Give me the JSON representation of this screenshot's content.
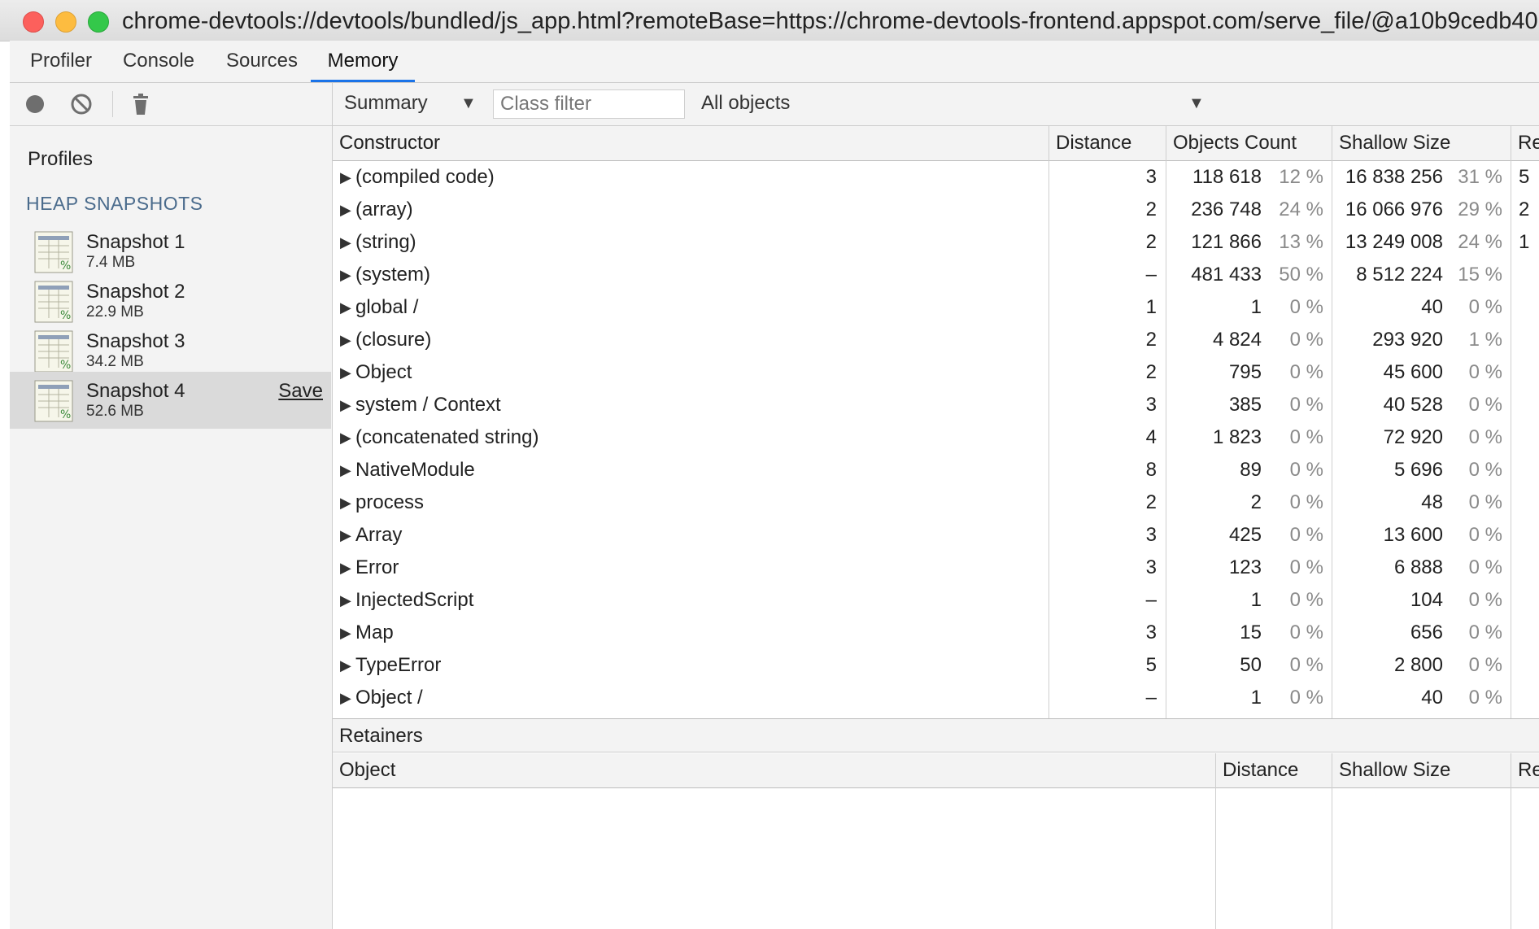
{
  "window": {
    "url": "chrome-devtools://devtools/bundled/js_app.html?remoteBase=https://chrome-devtools-frontend.appspot.com/serve_file/@a10b9cedb40738cb152f"
  },
  "tabs": [
    {
      "label": "Profiler"
    },
    {
      "label": "Console"
    },
    {
      "label": "Sources"
    },
    {
      "label": "Memory",
      "active": true
    }
  ],
  "sidebar": {
    "profiles_label": "Profiles",
    "section_label": "HEAP SNAPSHOTS",
    "snapshots": [
      {
        "name": "Snapshot 1",
        "size": "7.4 MB"
      },
      {
        "name": "Snapshot 2",
        "size": "22.9 MB"
      },
      {
        "name": "Snapshot 3",
        "size": "34.2 MB"
      },
      {
        "name": "Snapshot 4",
        "size": "52.6 MB",
        "selected": true,
        "save_label": "Save"
      }
    ]
  },
  "filterbar": {
    "view": "Summary",
    "class_filter_placeholder": "Class filter",
    "objects": "All objects"
  },
  "table": {
    "headers": {
      "constructor": "Constructor",
      "distance": "Distance",
      "objects_count": "Objects Count",
      "shallow_size": "Shallow Size",
      "retained": "Re"
    },
    "rows": [
      {
        "name": "(compiled code)",
        "distance": "3",
        "count": "118 618",
        "count_pct": "12 %",
        "shallow": "16 838 256",
        "shallow_pct": "31 %",
        "retained": "5"
      },
      {
        "name": "(array)",
        "distance": "2",
        "count": "236 748",
        "count_pct": "24 %",
        "shallow": "16 066 976",
        "shallow_pct": "29 %",
        "retained": "2"
      },
      {
        "name": "(string)",
        "distance": "2",
        "count": "121 866",
        "count_pct": "13 %",
        "shallow": "13 249 008",
        "shallow_pct": "24 %",
        "retained": "1"
      },
      {
        "name": "(system)",
        "distance": "–",
        "count": "481 433",
        "count_pct": "50 %",
        "shallow": "8 512 224",
        "shallow_pct": "15 %",
        "retained": ""
      },
      {
        "name": "global /",
        "distance": "1",
        "count": "1",
        "count_pct": "0 %",
        "shallow": "40",
        "shallow_pct": "0 %",
        "retained": ""
      },
      {
        "name": "(closure)",
        "distance": "2",
        "count": "4 824",
        "count_pct": "0 %",
        "shallow": "293 920",
        "shallow_pct": "1 %",
        "retained": ""
      },
      {
        "name": "Object",
        "distance": "2",
        "count": "795",
        "count_pct": "0 %",
        "shallow": "45 600",
        "shallow_pct": "0 %",
        "retained": ""
      },
      {
        "name": "system / Context",
        "distance": "3",
        "count": "385",
        "count_pct": "0 %",
        "shallow": "40 528",
        "shallow_pct": "0 %",
        "retained": ""
      },
      {
        "name": "(concatenated string)",
        "distance": "4",
        "count": "1 823",
        "count_pct": "0 %",
        "shallow": "72 920",
        "shallow_pct": "0 %",
        "retained": ""
      },
      {
        "name": "NativeModule",
        "distance": "8",
        "count": "89",
        "count_pct": "0 %",
        "shallow": "5 696",
        "shallow_pct": "0 %",
        "retained": ""
      },
      {
        "name": "process",
        "distance": "2",
        "count": "2",
        "count_pct": "0 %",
        "shallow": "48",
        "shallow_pct": "0 %",
        "retained": ""
      },
      {
        "name": "Array",
        "distance": "3",
        "count": "425",
        "count_pct": "0 %",
        "shallow": "13 600",
        "shallow_pct": "0 %",
        "retained": ""
      },
      {
        "name": "Error",
        "distance": "3",
        "count": "123",
        "count_pct": "0 %",
        "shallow": "6 888",
        "shallow_pct": "0 %",
        "retained": ""
      },
      {
        "name": "InjectedScript",
        "distance": "–",
        "count": "1",
        "count_pct": "0 %",
        "shallow": "104",
        "shallow_pct": "0 %",
        "retained": ""
      },
      {
        "name": "Map",
        "distance": "3",
        "count": "15",
        "count_pct": "0 %",
        "shallow": "656",
        "shallow_pct": "0 %",
        "retained": ""
      },
      {
        "name": "TypeError",
        "distance": "5",
        "count": "50",
        "count_pct": "0 %",
        "shallow": "2 800",
        "shallow_pct": "0 %",
        "retained": ""
      },
      {
        "name": "Object /",
        "distance": "–",
        "count": "1",
        "count_pct": "0 %",
        "shallow": "40",
        "shallow_pct": "0 %",
        "retained": ""
      }
    ]
  },
  "retainers": {
    "title": "Retainers",
    "headers": {
      "object": "Object",
      "distance": "Distance",
      "shallow_size": "Shallow Size",
      "retained": "Re"
    }
  },
  "icons": {
    "record": "record-icon",
    "clear": "clear-icon",
    "delete": "trash-icon",
    "snapshot": "snapshot-icon",
    "expand": "triangle-right-icon"
  },
  "colors": {
    "active_tab": "#1a73e8",
    "selected_row": "#dadada",
    "section_label": "#4a6b8c"
  }
}
